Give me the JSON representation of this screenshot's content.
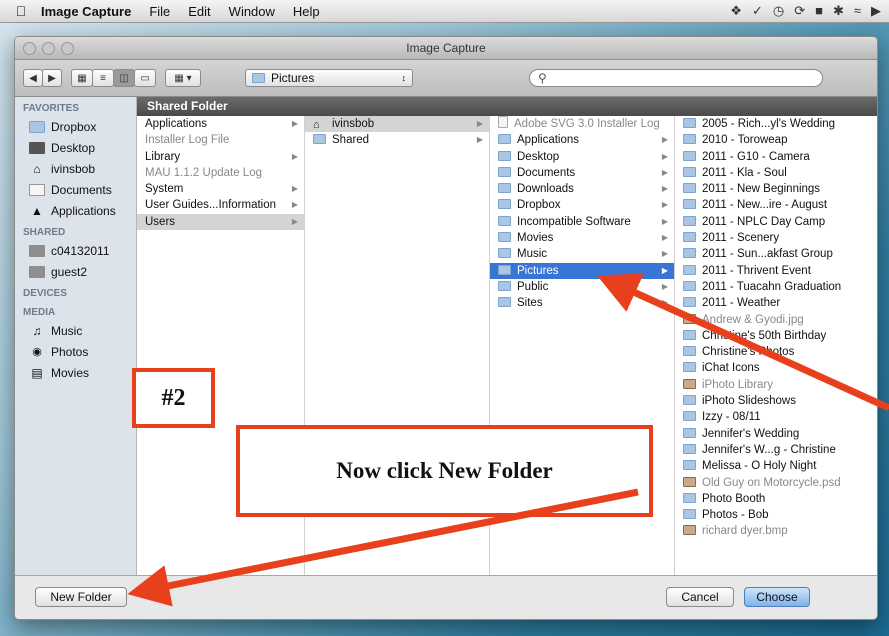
{
  "menubar": {
    "app": "Image Capture",
    "items": [
      "File",
      "Edit",
      "Window",
      "Help"
    ]
  },
  "window": {
    "title": "Image Capture",
    "path_popup": "Pictures",
    "search_placeholder": ""
  },
  "sidebar": {
    "sections": [
      {
        "title": "FAVORITES",
        "items": [
          {
            "label": "Dropbox",
            "icon": "folder-icon"
          },
          {
            "label": "Desktop",
            "icon": "desktop-icon"
          },
          {
            "label": "ivinsbob",
            "icon": "home-icon"
          },
          {
            "label": "Documents",
            "icon": "documents-icon"
          },
          {
            "label": "Applications",
            "icon": "applications-icon"
          }
        ]
      },
      {
        "title": "SHARED",
        "items": [
          {
            "label": "c04132011",
            "icon": "computer-icon"
          },
          {
            "label": "guest2",
            "icon": "computer-icon"
          }
        ]
      },
      {
        "title": "DEVICES",
        "items": []
      },
      {
        "title": "MEDIA",
        "items": [
          {
            "label": "Music",
            "icon": "music-icon"
          },
          {
            "label": "Photos",
            "icon": "camera-icon"
          },
          {
            "label": "Movies",
            "icon": "film-icon"
          }
        ]
      }
    ]
  },
  "browser": {
    "header": "Shared Folder",
    "col1": [
      {
        "label": "Applications",
        "arrow": true
      },
      {
        "label": "Installer Log File",
        "dim": true
      },
      {
        "label": "Library",
        "arrow": true
      },
      {
        "label": "MAU 1.1.2 Update Log",
        "dim": true
      },
      {
        "label": "System",
        "arrow": true
      },
      {
        "label": "User Guides...Information",
        "arrow": true
      },
      {
        "label": "Users",
        "arrow": true,
        "selected": "gray"
      }
    ],
    "col2": [
      {
        "label": "ivinsbob",
        "arrow": true,
        "selected": "gray",
        "icon": "home-icon"
      },
      {
        "label": "Shared",
        "arrow": true,
        "icon": "folder-icon"
      }
    ],
    "col3": [
      {
        "label": "Adobe SVG 3.0 Installer Log",
        "dim": true,
        "icon": "document-icon"
      },
      {
        "label": "Applications",
        "arrow": true
      },
      {
        "label": "Desktop",
        "arrow": true
      },
      {
        "label": "Documents",
        "arrow": true
      },
      {
        "label": "Downloads",
        "arrow": true
      },
      {
        "label": "Dropbox",
        "arrow": true
      },
      {
        "label": "Incompatible Software",
        "arrow": true
      },
      {
        "label": "Movies",
        "arrow": true
      },
      {
        "label": "Music",
        "arrow": true
      },
      {
        "label": "Pictures",
        "arrow": true,
        "selected": "blue"
      },
      {
        "label": "Public",
        "arrow": true
      },
      {
        "label": "Sites",
        "arrow": true
      }
    ],
    "col4": [
      {
        "label": "2005 - Rich...yl's Wedding"
      },
      {
        "label": "2010 - Toroweap"
      },
      {
        "label": "2011 - G10 - Camera"
      },
      {
        "label": "2011 - Kla - Soul"
      },
      {
        "label": "2011 - New Beginnings"
      },
      {
        "label": "2011 - New...ire - August"
      },
      {
        "label": "2011 - NPLC Day Camp"
      },
      {
        "label": "2011 - Scenery"
      },
      {
        "label": "2011 - Sun...akfast Group"
      },
      {
        "label": "2011 - Thrivent Event"
      },
      {
        "label": "2011 - Tuacahn Graduation"
      },
      {
        "label": "2011 - Weather"
      },
      {
        "label": "Andrew & Gyodi.jpg",
        "dim": true,
        "icon": "image-icon"
      },
      {
        "label": "Christine's 50th Birthday"
      },
      {
        "label": "Christine's Photos"
      },
      {
        "label": "iChat Icons"
      },
      {
        "label": "iPhoto Library",
        "dim": true,
        "icon": "image-icon"
      },
      {
        "label": "iPhoto Slideshows"
      },
      {
        "label": "Izzy - 08/11"
      },
      {
        "label": "Jennifer's Wedding"
      },
      {
        "label": "Jennifer's W...g - Christine"
      },
      {
        "label": "Melissa - O Holy Night"
      },
      {
        "label": "Old Guy on Motorcycle.psd",
        "dim": true,
        "icon": "image-icon"
      },
      {
        "label": "Photo Booth"
      },
      {
        "label": "Photos - Bob"
      },
      {
        "label": "richard dyer.bmp",
        "dim": true,
        "icon": "image-icon"
      }
    ]
  },
  "buttons": {
    "new_folder": "New Folder",
    "cancel": "Cancel",
    "choose": "Choose"
  },
  "annotations": {
    "step": "#2",
    "instruction": "Now click New Folder",
    "accent_color": "#e8401c"
  }
}
